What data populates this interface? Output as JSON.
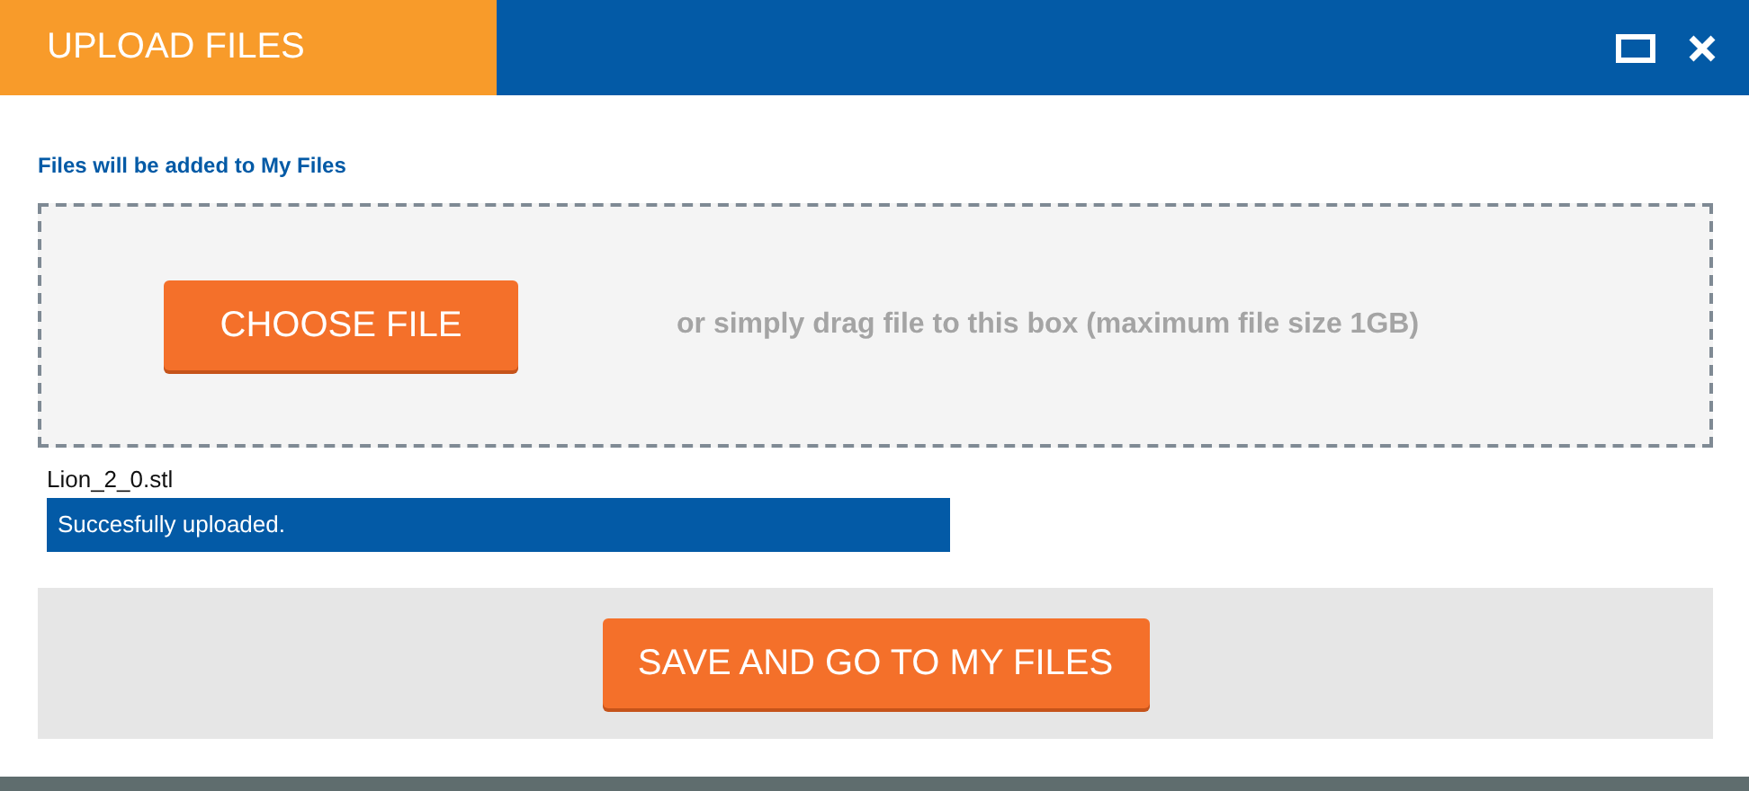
{
  "window": {
    "title": "UPLOAD FILES"
  },
  "destination_note": "Files will be added to My Files",
  "dropzone": {
    "button": "CHOOSE FILE",
    "hint": "or simply drag file to this box (maximum file size 1GB)"
  },
  "uploads": [
    {
      "file_name": "Lion_2_0.stl",
      "status": "Succesfully uploaded."
    }
  ],
  "footer": {
    "button": "SAVE AND GO TO MY FILES"
  }
}
